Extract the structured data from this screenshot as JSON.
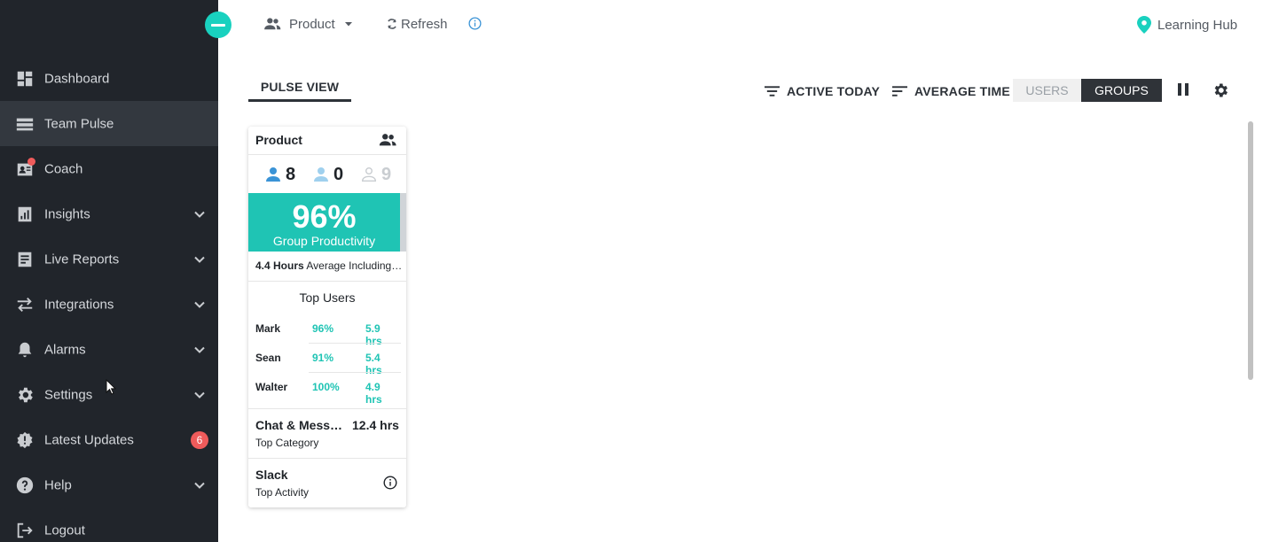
{
  "sidebar": {
    "items": [
      {
        "label": "Dashboard",
        "icon": "dashboard-icon"
      },
      {
        "label": "Team Pulse",
        "icon": "team-pulse-icon",
        "active": true
      },
      {
        "label": "Coach",
        "icon": "coach-icon",
        "notification_dot": true
      },
      {
        "label": "Insights",
        "icon": "insights-icon",
        "expandable": true
      },
      {
        "label": "Live Reports",
        "icon": "live-reports-icon",
        "expandable": true
      },
      {
        "label": "Integrations",
        "icon": "integrations-icon",
        "expandable": true
      },
      {
        "label": "Alarms",
        "icon": "bell-icon",
        "expandable": true
      },
      {
        "label": "Settings",
        "icon": "gear-icon",
        "expandable": true
      },
      {
        "label": "Latest Updates",
        "icon": "badge-icon",
        "badge": "6"
      },
      {
        "label": "Help",
        "icon": "help-icon",
        "expandable": true
      },
      {
        "label": "Logout",
        "icon": "logout-icon"
      }
    ]
  },
  "topbar": {
    "group_selector": "Product",
    "refresh_label": "Refresh",
    "learning_hub_label": "Learning Hub"
  },
  "view": {
    "tab_label": "PULSE VIEW",
    "filter_active_label": "ACTIVE TODAY",
    "filter_avg_label": "AVERAGE TIME",
    "toggle_users_label": "USERS",
    "toggle_groups_label": "GROUPS",
    "selected_toggle": "GROUPS"
  },
  "card": {
    "title": "Product",
    "counts": {
      "active": "8",
      "idle": "0",
      "offline": "9"
    },
    "productivity_percent": "96%",
    "productivity_label": "Group Productivity",
    "avg_hours": "4.4 Hours",
    "avg_text": "Average Including…",
    "top_users_title": "Top Users",
    "top_users": [
      {
        "name": "Mark",
        "pct": "96%",
        "hrs": "5.9 hrs"
      },
      {
        "name": "Sean",
        "pct": "91%",
        "hrs": "5.4 hrs"
      },
      {
        "name": "Walter",
        "pct": "100%",
        "hrs": "4.9 hrs"
      }
    ],
    "top_category": "Chat & Messa…",
    "top_category_hours": "12.4 hrs",
    "top_category_label": "Top Category",
    "top_activity": "Slack",
    "top_activity_label": "Top Activity"
  },
  "colors": {
    "sidebar_bg": "#21252b",
    "accent_teal": "#1fc4b4",
    "badge_red": "#ef5b5b",
    "active_blue": "#3a93d6",
    "idle_lightblue": "#9fd0ee"
  }
}
